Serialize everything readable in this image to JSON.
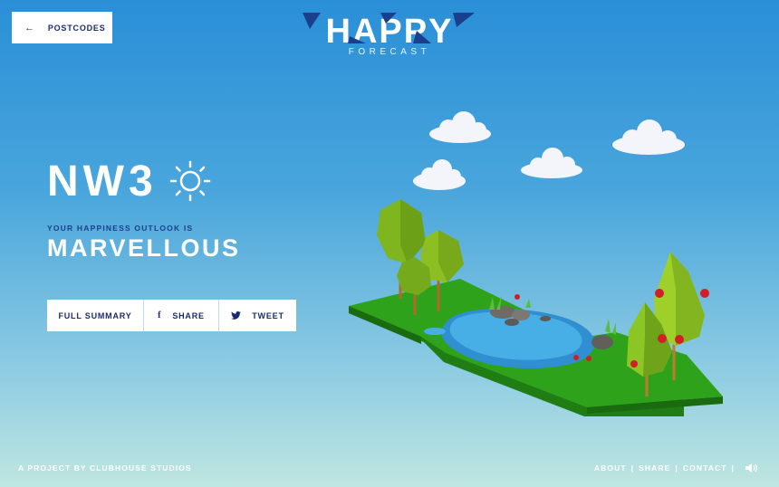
{
  "header": {
    "back_arrow": "←",
    "back_label": "POSTCODES",
    "logo_text": "HAPPY",
    "logo_sub": "FORECAST"
  },
  "hero": {
    "postcode": "NW3",
    "weather_icon": "sun-icon",
    "outlook_label": "YOUR HAPPINESS OUTLOOK IS",
    "outlook_value": "MARVELLOUS"
  },
  "actions": {
    "summary_label": "FULL SUMMARY",
    "share_icon": "f",
    "share_label": "SHARE",
    "tweet_label": "TWEET"
  },
  "footer": {
    "credit": "A PROJECT BY CLUBHOUSE STUDIOS",
    "links": [
      "ABOUT",
      "SHARE",
      "CONTACT"
    ],
    "separator": "|"
  },
  "colors": {
    "navy": "#1c2a6b",
    "accent_blue": "#1a3f8c",
    "grass": "#2e9a1c",
    "water": "#2f8fd0"
  }
}
